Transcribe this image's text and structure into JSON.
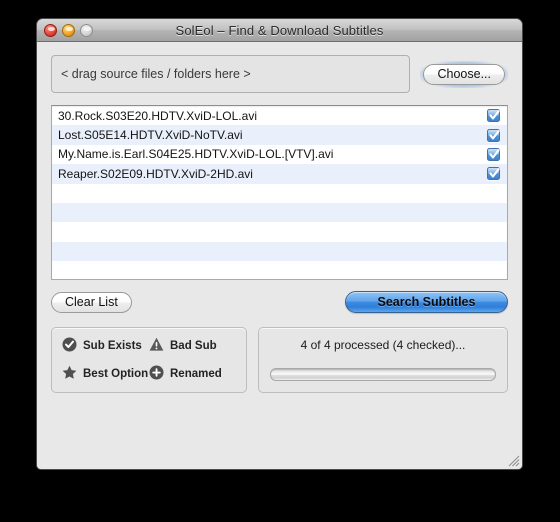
{
  "window": {
    "title": "SolEol – Find & Download Subtitles",
    "controls": {
      "close": "close-button",
      "minimize": "minimize-button",
      "zoom": "zoom-button"
    }
  },
  "source": {
    "dropzone_text": "< drag source files / folders here >",
    "choose_label": "Choose..."
  },
  "file_list": {
    "rows": [
      {
        "name": "30.Rock.S03E20.HDTV.XviD-LOL.avi",
        "checked": true
      },
      {
        "name": "Lost.S05E14.HDTV.XviD-NoTV.avi",
        "checked": true
      },
      {
        "name": "My.Name.is.Earl.S04E25.HDTV.XviD-LOL.[VTV].avi",
        "checked": true
      },
      {
        "name": "Reaper.S02E09.HDTV.XviD-2HD.avi",
        "checked": true
      }
    ],
    "empty_row_count": 5
  },
  "actions": {
    "clear_label": "Clear List",
    "search_label": "Search Subtitles"
  },
  "legend": {
    "items": [
      {
        "icon": "check-circle-icon",
        "label": "Sub Exists"
      },
      {
        "icon": "warning-triangle-icon",
        "label": "Bad Sub"
      },
      {
        "icon": "star-icon",
        "label": "Best Option"
      },
      {
        "icon": "plus-circle-icon",
        "label": "Renamed"
      }
    ]
  },
  "status": {
    "text": "4 of 4 processed (4 checked)...",
    "progress_percent": 0
  },
  "colors": {
    "accent_blue": "#3d8ae2",
    "row_alt": "#eaf0fb",
    "window_bg": "#e8e8e8",
    "close_red": "#e8463a",
    "minimize_yellow": "#f6a425"
  }
}
